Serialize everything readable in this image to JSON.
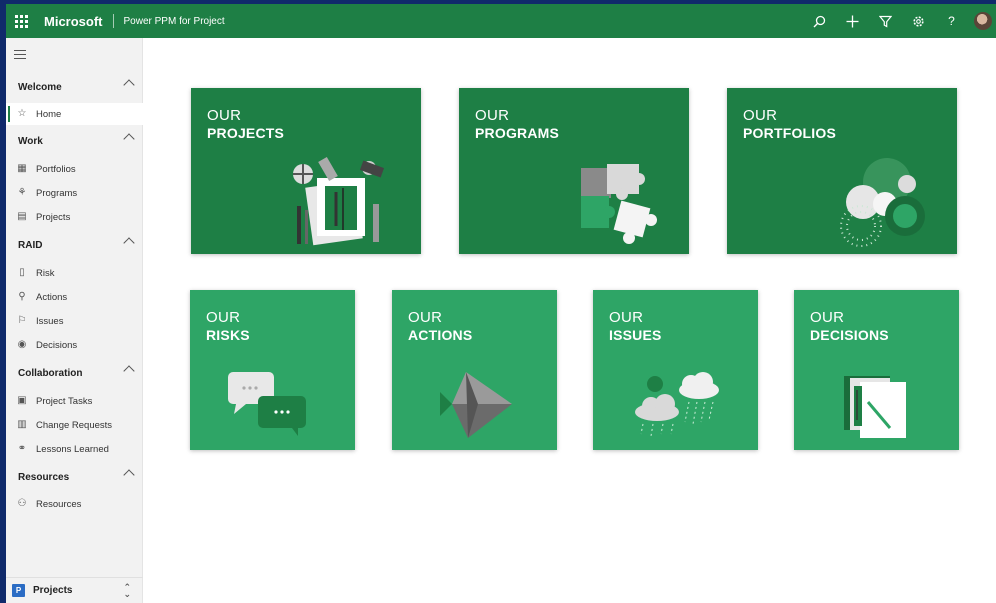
{
  "header": {
    "brand": "Microsoft",
    "app_name": "Power PPM for Project"
  },
  "sidebar": {
    "groups": [
      {
        "label": "Welcome",
        "items": [
          {
            "label": "Home",
            "icon": "star-icon",
            "active": true
          }
        ]
      },
      {
        "label": "Work",
        "items": [
          {
            "label": "Portfolios",
            "icon": "portfolio-icon"
          },
          {
            "label": "Programs",
            "icon": "hierarchy-icon"
          },
          {
            "label": "Projects",
            "icon": "project-board-icon"
          }
        ]
      },
      {
        "label": "RAID",
        "items": [
          {
            "label": "Risk",
            "icon": "risk-document-icon"
          },
          {
            "label": "Actions",
            "icon": "actions-icon"
          },
          {
            "label": "Issues",
            "icon": "flag-icon"
          },
          {
            "label": "Decisions",
            "icon": "decision-icon"
          }
        ]
      },
      {
        "label": "Collaboration",
        "items": [
          {
            "label": "Project Tasks",
            "icon": "task-clipboard-icon"
          },
          {
            "label": "Change Requests",
            "icon": "change-request-icon"
          },
          {
            "label": "Lessons Learned",
            "icon": "lessons-icon"
          }
        ]
      },
      {
        "label": "Resources",
        "items": [
          {
            "label": "Resources",
            "icon": "people-icon"
          }
        ]
      }
    ],
    "area_switcher": {
      "badge": "P",
      "label": "Projects"
    }
  },
  "tiles": [
    {
      "line1": "OUR",
      "line2": "PROJECTS",
      "illustration": "drafting-tools-illustration"
    },
    {
      "line1": "OUR",
      "line2": "PROGRAMS",
      "illustration": "puzzle-pieces-illustration"
    },
    {
      "line1": "OUR",
      "line2": "PORTFOLIOS",
      "illustration": "circles-illustration"
    },
    {
      "line1": "OUR",
      "line2": "RISKS",
      "illustration": "speech-bubbles-illustration"
    },
    {
      "line1": "OUR",
      "line2": "ACTIONS",
      "illustration": "paper-plane-illustration"
    },
    {
      "line1": "OUR",
      "line2": "ISSUES",
      "illustration": "storm-clouds-illustration"
    },
    {
      "line1": "OUR",
      "line2": "DECISIONS",
      "illustration": "documents-illustration"
    }
  ],
  "colors": {
    "topbar": "#1e7f45",
    "tile_dark": "#1e7f45",
    "tile_light": "#2ea566",
    "badge": "#2b6cc4"
  }
}
